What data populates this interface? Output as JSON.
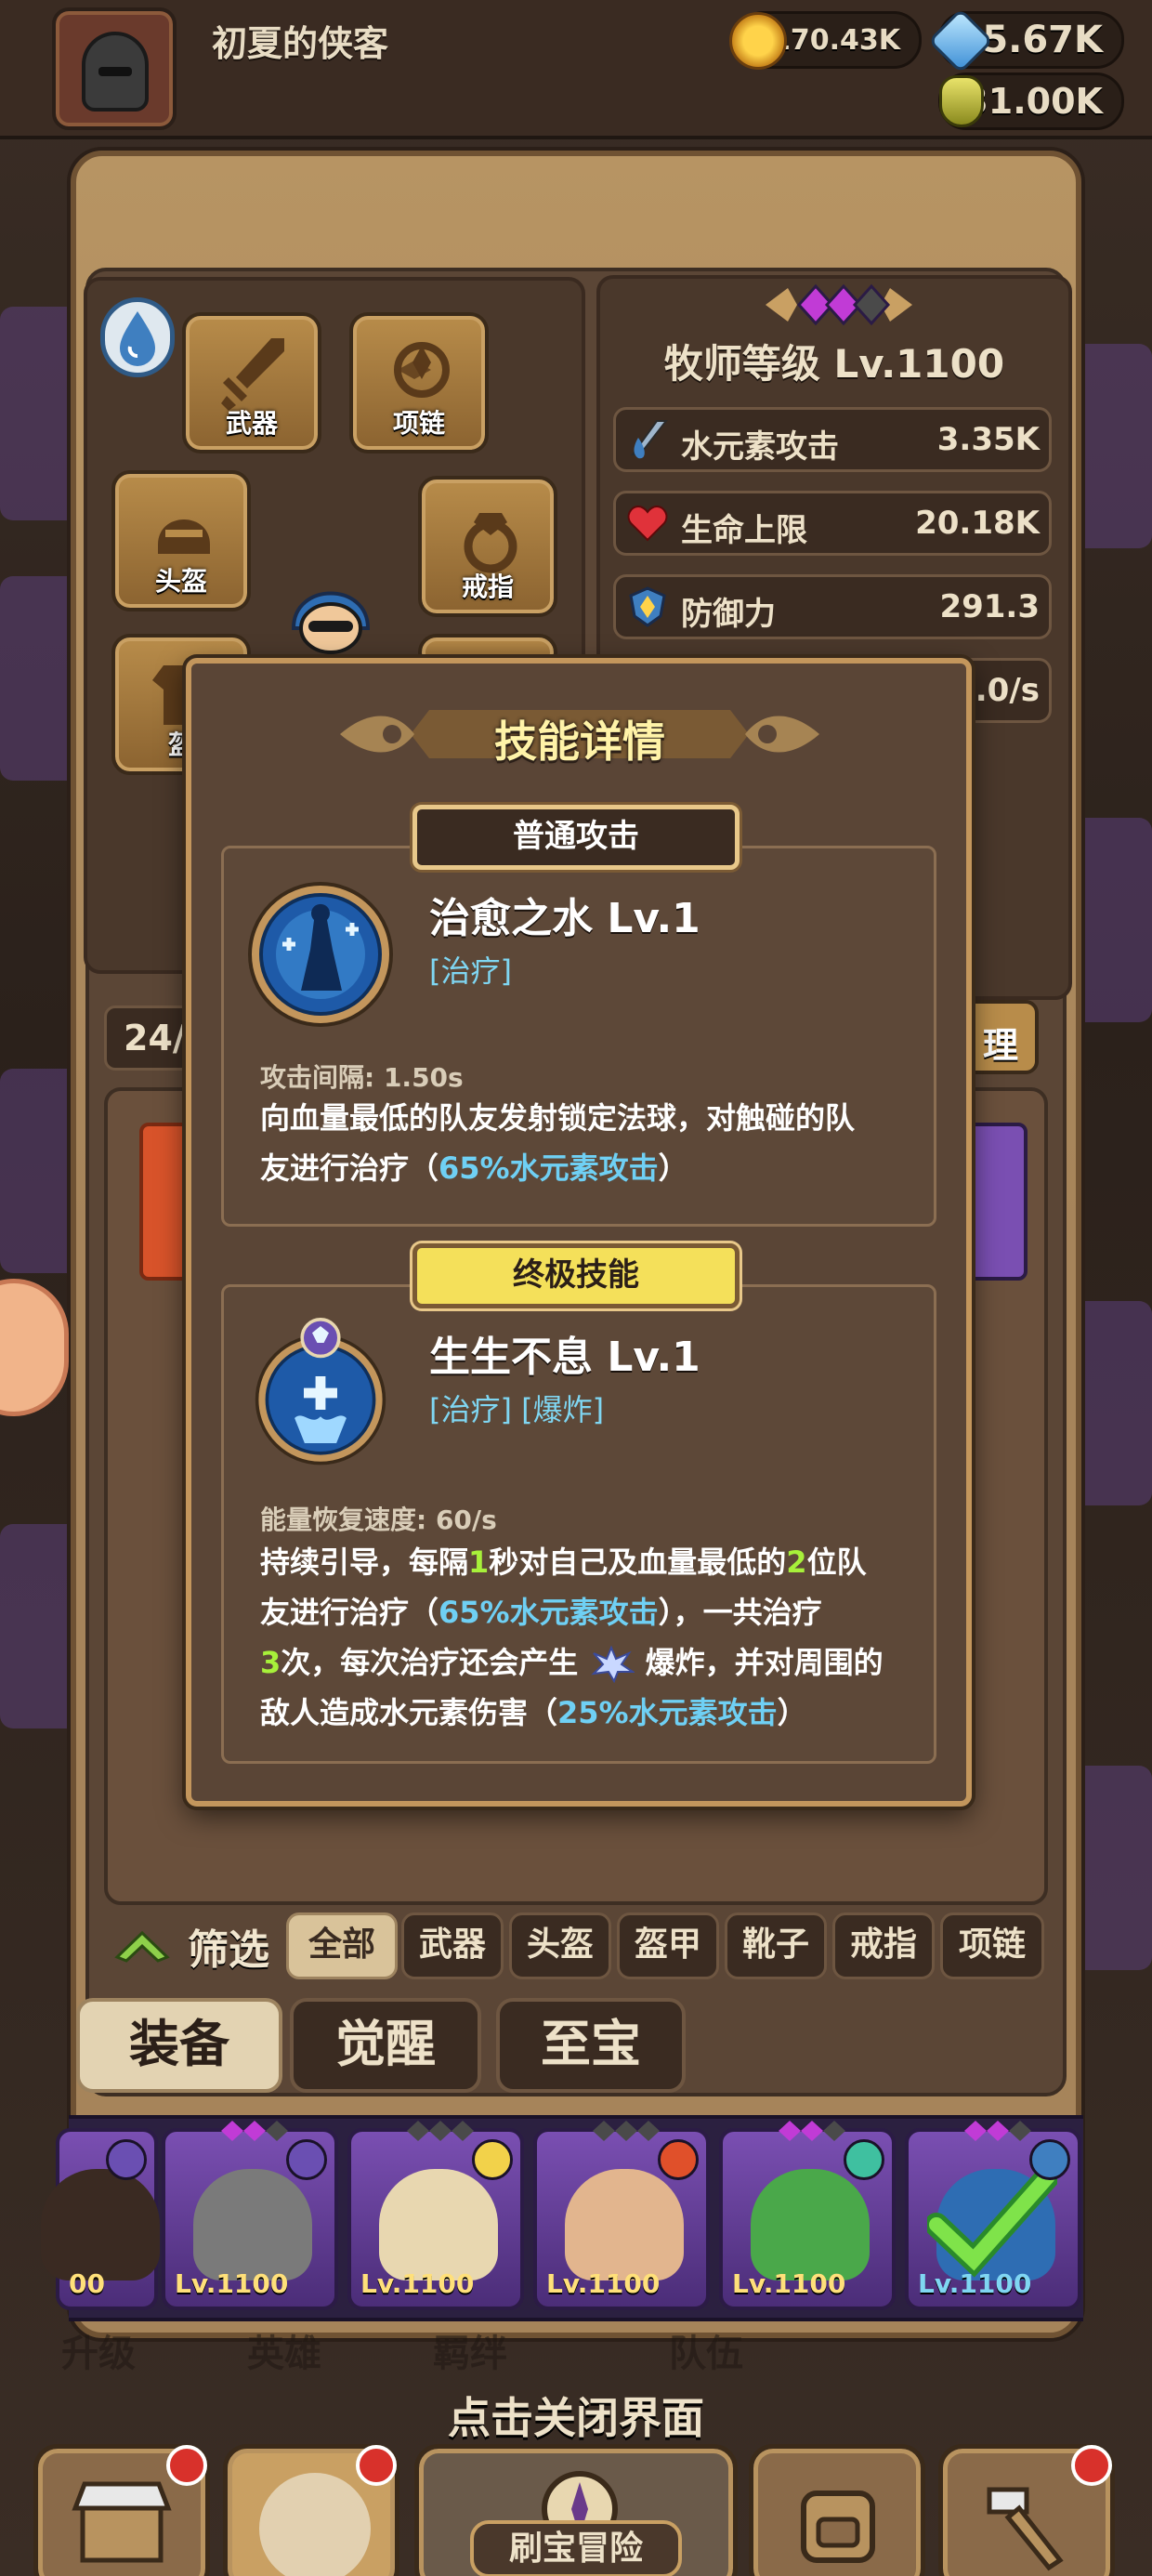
{
  "player": {
    "name": "初夏的侠客"
  },
  "currency": {
    "gold": "170.43K",
    "gems": "5.67K",
    "potion": "31.00K"
  },
  "equipment_slots": [
    {
      "label": "武器",
      "icon": "sword-icon"
    },
    {
      "label": "项链",
      "icon": "necklace-icon"
    },
    {
      "label": "头盔",
      "icon": "helmet-icon"
    },
    {
      "label": "戒指",
      "icon": "ring-icon"
    },
    {
      "label": "盔",
      "icon": "armor-icon"
    }
  ],
  "stats": {
    "class_level": "牧师等级 Lv.1100",
    "rows": [
      {
        "name": "水元素攻击",
        "value": "3.35K",
        "icon": "water-attack-icon"
      },
      {
        "name": "生命上限",
        "value": "20.18K",
        "icon": "heart-icon"
      },
      {
        "name": "防御力",
        "value": "291.3",
        "icon": "shield-icon"
      },
      {
        "name": "",
        "value": "0.0/s",
        "icon": ""
      }
    ]
  },
  "inventory": {
    "count": "24/",
    "right_button": "理"
  },
  "dialog": {
    "title": "技能详情",
    "normal": {
      "section_label": "普通攻击",
      "name": "治愈之水 Lv.1",
      "tags": "[治疗]",
      "meta": "攻击间隔: 1.50s",
      "desc_line1": "向血量最低的队友发射锁定法球，对触碰的队",
      "desc_line2_a": "友进行治疗（",
      "desc_line2_b": "65%水元素攻击",
      "desc_line2_c": "）"
    },
    "ultimate": {
      "section_label": "终极技能",
      "name": "生生不息 Lv.1",
      "tags": "[治疗] [爆炸]",
      "meta": "能量恢复速度: 60/s",
      "l1_a": "持续引导，每隔",
      "l1_n1": "1",
      "l1_b": "秒对自己及血量最低的",
      "l1_n2": "2",
      "l1_c": "位队",
      "l2_a": "友进行治疗（",
      "l2_hl": "65%水元素攻击",
      "l2_b": "），一共治疗",
      "l3_n": "3",
      "l3_a": "次，每次治疗还会产生 ",
      "l3_b": " 爆炸，并对周围的",
      "l4_a": "敌人造成水元素伤害（",
      "l4_hl": "25%水元素攻击",
      "l4_b": "）"
    }
  },
  "filter": {
    "label": "筛选",
    "chips": [
      "全部",
      "武器",
      "头盔",
      "盔甲",
      "靴子",
      "戒指",
      "项链"
    ],
    "active": "全部"
  },
  "tabs": [
    "装备",
    "觉醒",
    "至宝"
  ],
  "heroes": [
    {
      "level": "00",
      "element": "moon"
    },
    {
      "level": "Lv.1100",
      "element": "moon"
    },
    {
      "level": "Lv.1100",
      "element": "light"
    },
    {
      "level": "Lv.1100",
      "element": "fire"
    },
    {
      "level": "Lv.1100",
      "element": "wind"
    },
    {
      "level": "Lv.1100",
      "element": "water"
    }
  ],
  "bottom": {
    "close_hint": "点击关闭界面",
    "adventure": "刷宝冒险",
    "faint_menu": [
      "升级",
      "英雄",
      "羁绊",
      "队伍"
    ]
  },
  "colors": {
    "accent_gold": "#c3965c",
    "highlight_blue": "#6fd0f4",
    "number_green": "#a7f03a",
    "ult_yellow": "#f4e05a"
  }
}
